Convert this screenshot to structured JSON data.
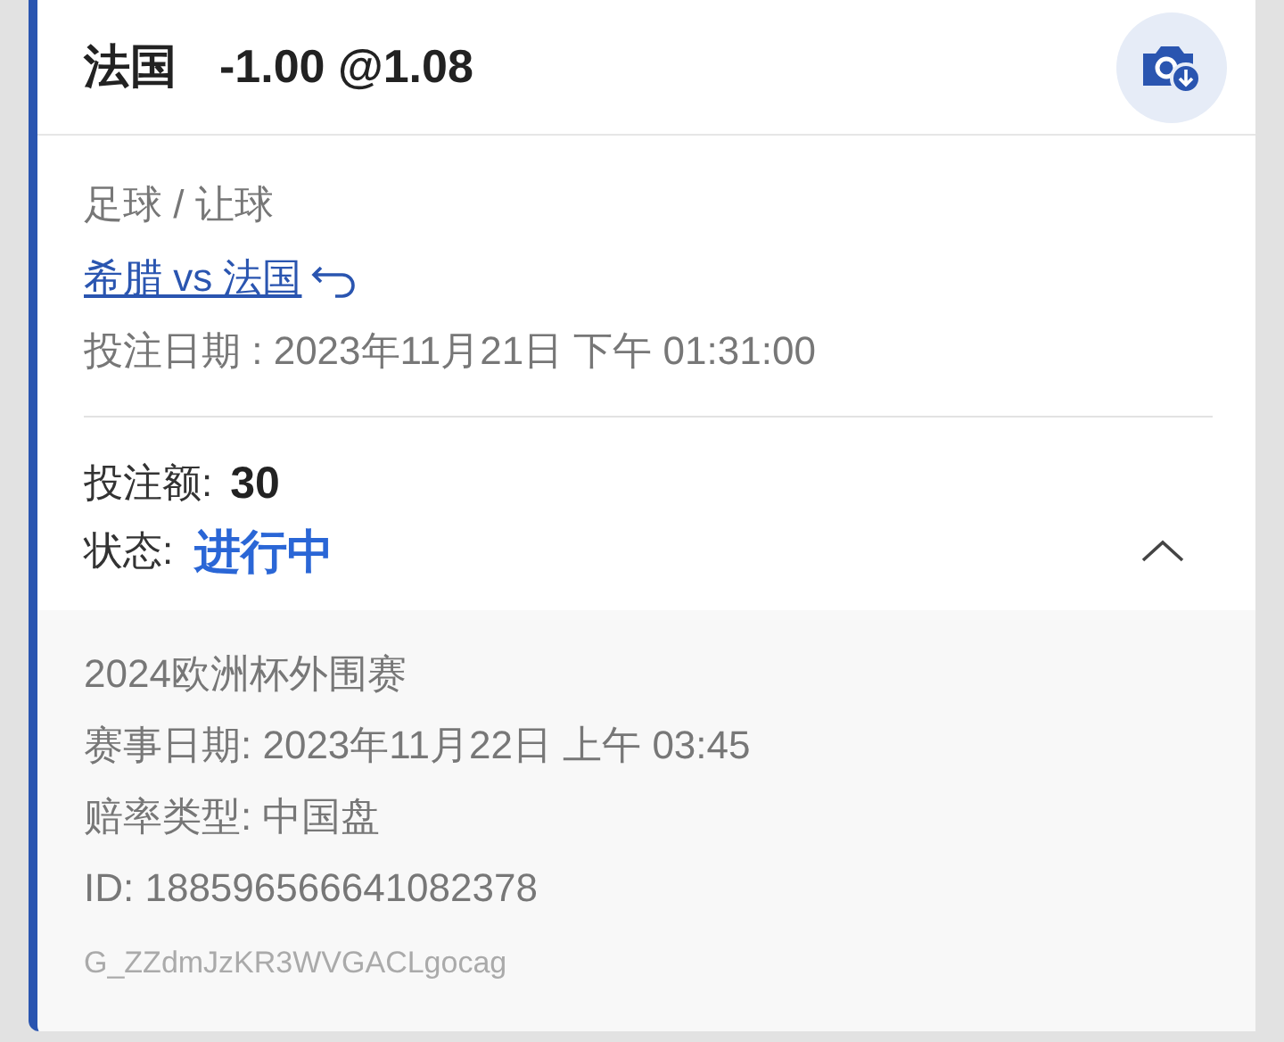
{
  "header": {
    "selection": "法国",
    "odds": "-1.00 @1.08"
  },
  "bet": {
    "sport": "足球 / 让球",
    "match_link": "希腊 vs 法国",
    "bet_date": "投注日期 : 2023年11月21日 下午 01:31:00"
  },
  "stake": {
    "label": "投注额:",
    "value": "30"
  },
  "status": {
    "label": "状态:",
    "value": "进行中",
    "expanded": true
  },
  "details": [
    "2024欧洲杯外围赛",
    "赛事日期: 2023年11月22日 上午 03:45",
    "赔率类型: 中国盘",
    "ID: 188596566641082378"
  ],
  "reference": "G_ZZdmJzKR3WVGACLgocag"
}
